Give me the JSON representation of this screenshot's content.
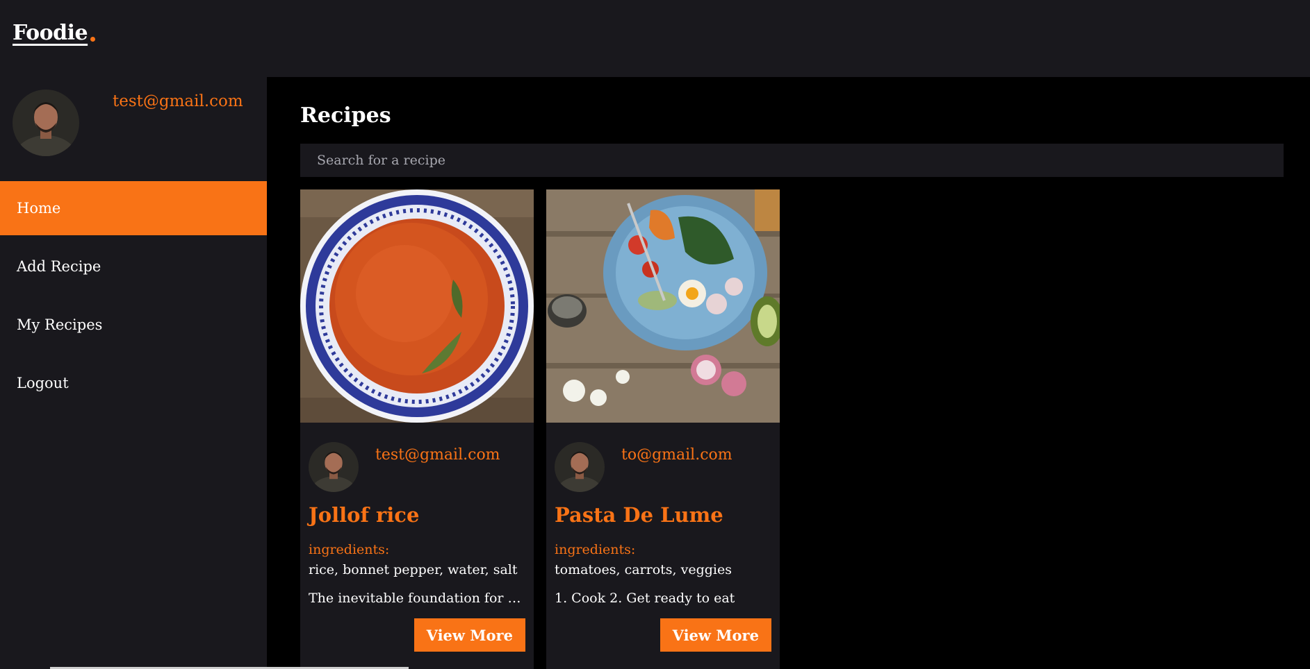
{
  "app": {
    "logo": "Foodie"
  },
  "profile": {
    "email": "test@gmail.com"
  },
  "nav": {
    "items": [
      {
        "label": "Home",
        "active": true
      },
      {
        "label": "Add Recipe"
      },
      {
        "label": "My Recipes"
      },
      {
        "label": "Logout"
      }
    ]
  },
  "main": {
    "title": "Recipes",
    "search_placeholder": "Search for a recipe"
  },
  "recipes": [
    {
      "author": "test@gmail.com",
      "title": "Jollof rice",
      "ingredients_label": "ingredients:",
      "ingredients": "rice, bonnet pepper, water, salt",
      "description": "The inevitable foundation for b...",
      "button": "View More"
    },
    {
      "author": "to@gmail.com",
      "title": "Pasta De Lume",
      "ingredients_label": "ingredients:",
      "ingredients": "tomatoes, carrots, veggies",
      "description": "1. Cook 2. Get ready to eat",
      "button": "View More"
    }
  ],
  "colors": {
    "accent": "#f97316",
    "panel": "#19181d",
    "background": "#000000"
  },
  "icons": {
    "avatar": "person-photo",
    "logo_dot": "dot-icon"
  }
}
